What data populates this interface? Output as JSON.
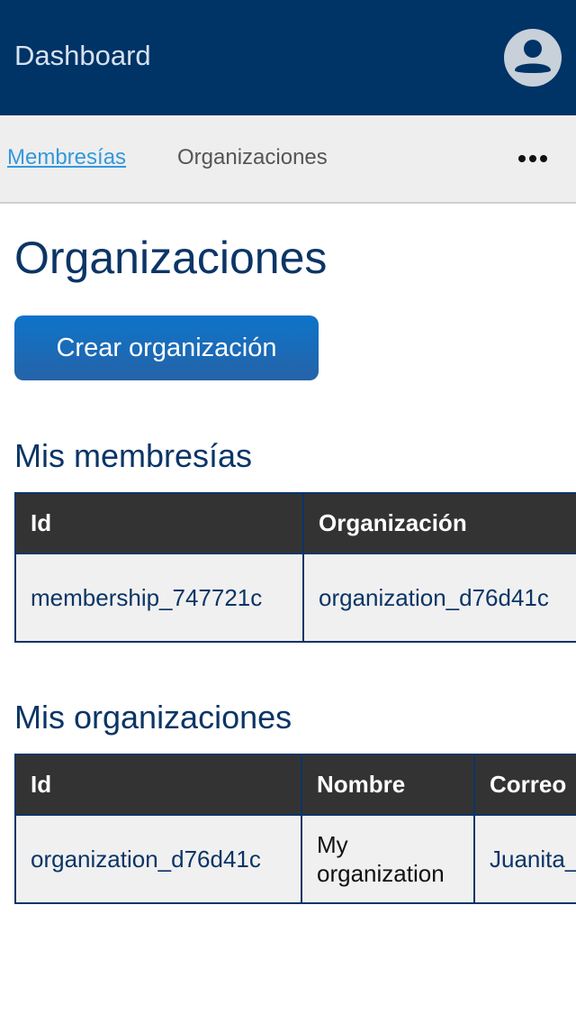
{
  "header": {
    "title": "Dashboard"
  },
  "tabs": [
    {
      "label": "Membresías",
      "active": true
    },
    {
      "label": "Organizaciones",
      "active": false
    }
  ],
  "more_icon": "more-horizontal-icon",
  "page": {
    "title": "Organizaciones",
    "create_button": "Crear organización"
  },
  "memberships": {
    "heading": "Mis membresías",
    "columns": [
      "Id",
      "Organización"
    ],
    "rows": [
      [
        "membership_747721c",
        "organization_d76d41c"
      ]
    ]
  },
  "organizations": {
    "heading": "Mis organizaciones",
    "columns": [
      "Id",
      "Nombre",
      "Correo"
    ],
    "rows": [
      [
        "organization_d76d41c",
        "My organization",
        "Juanita_"
      ]
    ]
  },
  "colors": {
    "appbar": "#003366",
    "accent": "#0e74c9",
    "link": "#3399dd",
    "table_header": "#333333"
  }
}
